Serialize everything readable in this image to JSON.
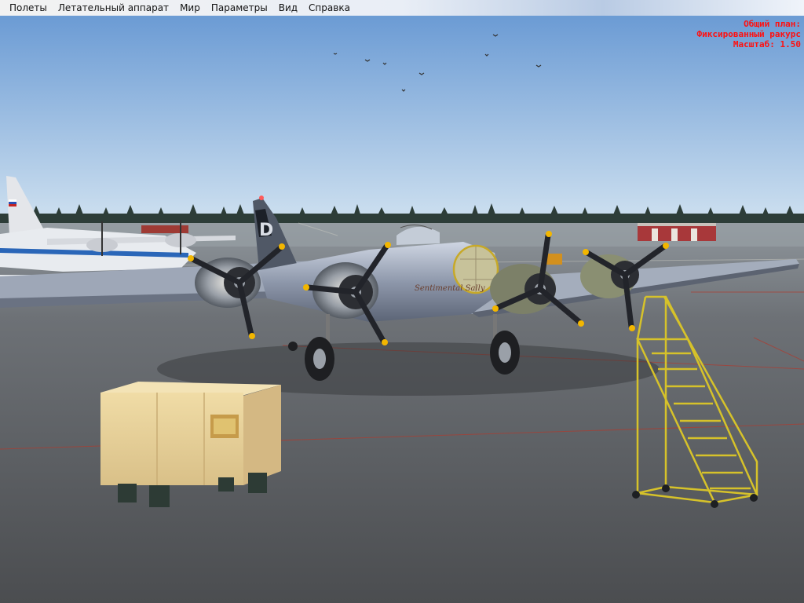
{
  "menu": {
    "items": [
      {
        "label": "Полеты"
      },
      {
        "label": "Летательный аппарат"
      },
      {
        "label": "Мир"
      },
      {
        "label": "Параметры"
      },
      {
        "label": "Вид"
      },
      {
        "label": "Справка"
      }
    ]
  },
  "hud": {
    "view_line": "Общий план:",
    "camera_line": "Фиксированный ракурс",
    "zoom_line": "Масштаб: 1.50"
  },
  "aircraft": {
    "tail_letter": "D",
    "nose_art": "Sentimental Sally"
  },
  "colors": {
    "hud_text": "#ff1010",
    "sky_top": "#6f9fd6",
    "sky_horizon": "#c7dcef",
    "tarmac": "#55585c",
    "stairs": "#d9c22a",
    "crate": "#e6cf96"
  }
}
